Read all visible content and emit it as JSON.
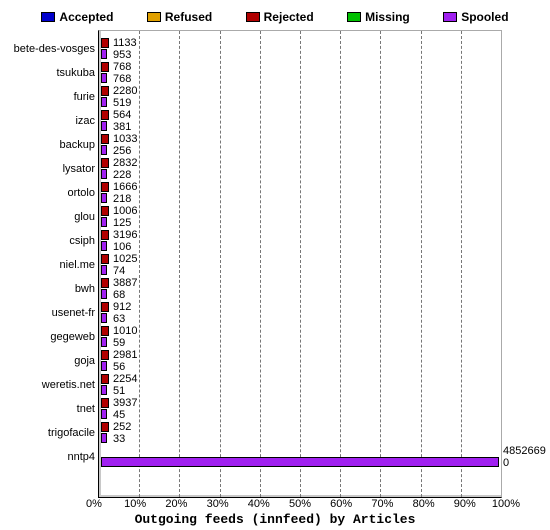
{
  "chart_data": {
    "type": "bar",
    "title": "Outgoing feeds (innfeed) by Articles",
    "xlabel": "",
    "ylabel": "",
    "x_unit": "%",
    "x_ticks": [
      0,
      10,
      20,
      30,
      40,
      50,
      60,
      70,
      80,
      90,
      100
    ],
    "legend": [
      {
        "name": "Accepted",
        "color": "#0000cc"
      },
      {
        "name": "Refused",
        "color": "#e0a000"
      },
      {
        "name": "Rejected",
        "color": "#b00000"
      },
      {
        "name": "Missing",
        "color": "#00c000"
      },
      {
        "name": "Spooled",
        "color": "#a020f0"
      }
    ],
    "categories": [
      "bete-des-vosges",
      "tsukuba",
      "furie",
      "izac",
      "backup",
      "lysator",
      "ortolo",
      "glou",
      "csiph",
      "niel.me",
      "bwh",
      "usenet-fr",
      "gegeweb",
      "goja",
      "weretis.net",
      "tnet",
      "trigofacile",
      "nntp4"
    ],
    "series": [
      {
        "name": "Rejected",
        "values": [
          1133,
          768,
          2280,
          564,
          1033,
          2832,
          1666,
          1006,
          3196,
          1025,
          3887,
          912,
          1010,
          2981,
          2254,
          3937,
          252,
          0
        ]
      },
      {
        "name": "Spooled",
        "values": [
          953,
          768,
          519,
          381,
          256,
          228,
          218,
          125,
          106,
          74,
          68,
          63,
          59,
          56,
          51,
          45,
          33,
          4852669
        ]
      }
    ],
    "note": "Rejected bars are visually tiny stubs; Spooled for nntp4 spans full width. Values shown are data labels printed on the chart."
  },
  "colors": {
    "accepted": "#0000cc",
    "refused": "#e0a000",
    "rejected": "#b00000",
    "missing": "#00c000",
    "spooled": "#a020f0"
  }
}
